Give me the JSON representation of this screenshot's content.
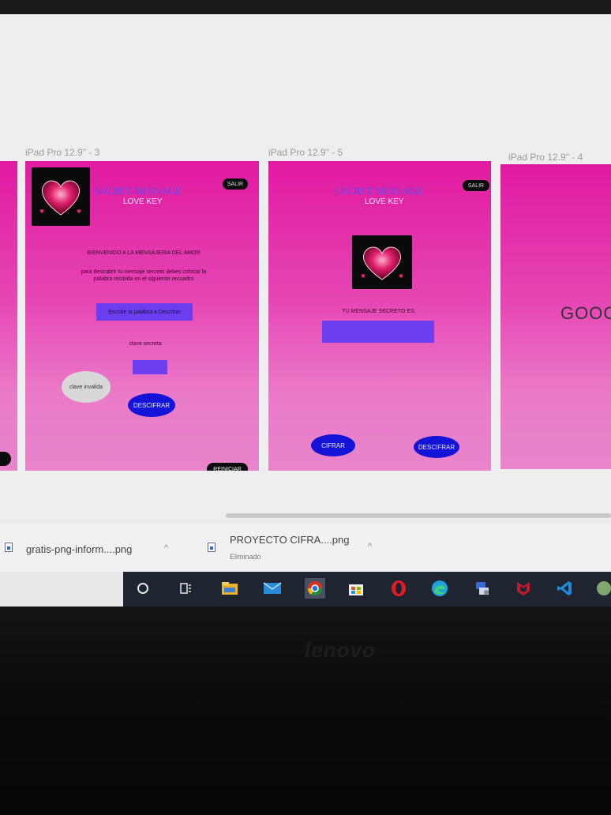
{
  "frames": [
    {
      "label": "iPad Pro 12.9\" - 3",
      "title": "SECRET MESSAGE",
      "subtitle": "LOVE KEY",
      "exit_button": "SALIR",
      "welcome": "BIENVENIDO A LA MENSAJERIA DEL AMOR",
      "instructions": "para descubrir tu mensaje secreto debes colocar la palabra recibida en el siguiente recuadro",
      "input_placeholder": "Escribe la palabra a Descifrar",
      "secret_key_label": "clave secreta",
      "error_bubble": "clave invalida",
      "decrypt_button": "DESCIFRAR",
      "reset_button": "REINICIAR"
    },
    {
      "label": "iPad Pro 12.9\" - 5",
      "title": "SECRET MESSAGE",
      "subtitle": "LOVE KEY",
      "exit_button": "SALIR",
      "message_label": "TU MENSAJE SECRETO ES:",
      "encrypt_button": "CIFRAR",
      "decrypt_button": "DESCIFRAR"
    },
    {
      "label": "iPad Pro 12.9\" - 4",
      "big_text": "GOOC"
    }
  ],
  "downloads": [
    {
      "name": "gratis-png-inform....png"
    },
    {
      "name": "PROYECTO CIFRA....png",
      "status": "Eliminado"
    }
  ],
  "taskbar": {
    "icons": [
      "search-icon",
      "task-view-icon",
      "file-explorer-icon",
      "mail-icon",
      "chrome-icon",
      "store-icon",
      "opera-icon",
      "edge-icon",
      "network-app-icon",
      "mcafee-icon",
      "vscode-icon",
      "app-icon"
    ]
  },
  "laptop_brand": "lenovo",
  "colors": {
    "artboard_pink": "#e01aa0",
    "title_blue": "#5a4cf0",
    "button_blue": "#1414d8",
    "input_purple": "#6b3ff0"
  }
}
